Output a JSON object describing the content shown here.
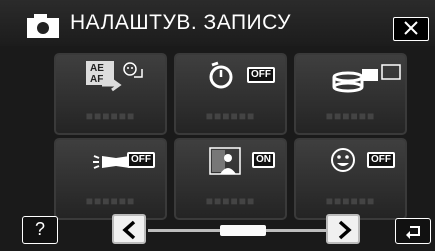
{
  "header": {
    "title": "НАЛАШТУВ. ЗАПИСУ",
    "camera_icon": "camera-icon",
    "close_icon": "close-icon"
  },
  "tiles": [
    {
      "name": "ae-af-tile",
      "icon": "ae-af-face-icon",
      "label": "■■■■■■",
      "badge": ""
    },
    {
      "name": "self-timer-tile",
      "icon": "self-timer-icon",
      "label": "■■■■■■",
      "badge": "OFF"
    },
    {
      "name": "continuous-shooting-tile",
      "icon": "continuous-shooting-icon",
      "label": "■■■■■■",
      "badge": ""
    },
    {
      "name": "light-tile",
      "icon": "light-icon",
      "label": "■■■■■■",
      "badge": "OFF"
    },
    {
      "name": "backlight-compensation-tile",
      "icon": "backlight-compensation-icon",
      "label": "■■■■■■",
      "badge": "ON"
    },
    {
      "name": "smile-shot-tile",
      "icon": "smile-face-icon",
      "label": "■■■■■■",
      "badge": "OFF"
    }
  ],
  "footer": {
    "help_label": "?",
    "prev_icon": "chevron-left-icon",
    "next_icon": "chevron-right-icon",
    "back_icon": "return-arrow-icon",
    "page_position": 0.5
  },
  "colors": {
    "background": "#1a1a1a",
    "tile": "#333333",
    "text": "#ffffff",
    "nav_button": "#f0f0f0"
  }
}
